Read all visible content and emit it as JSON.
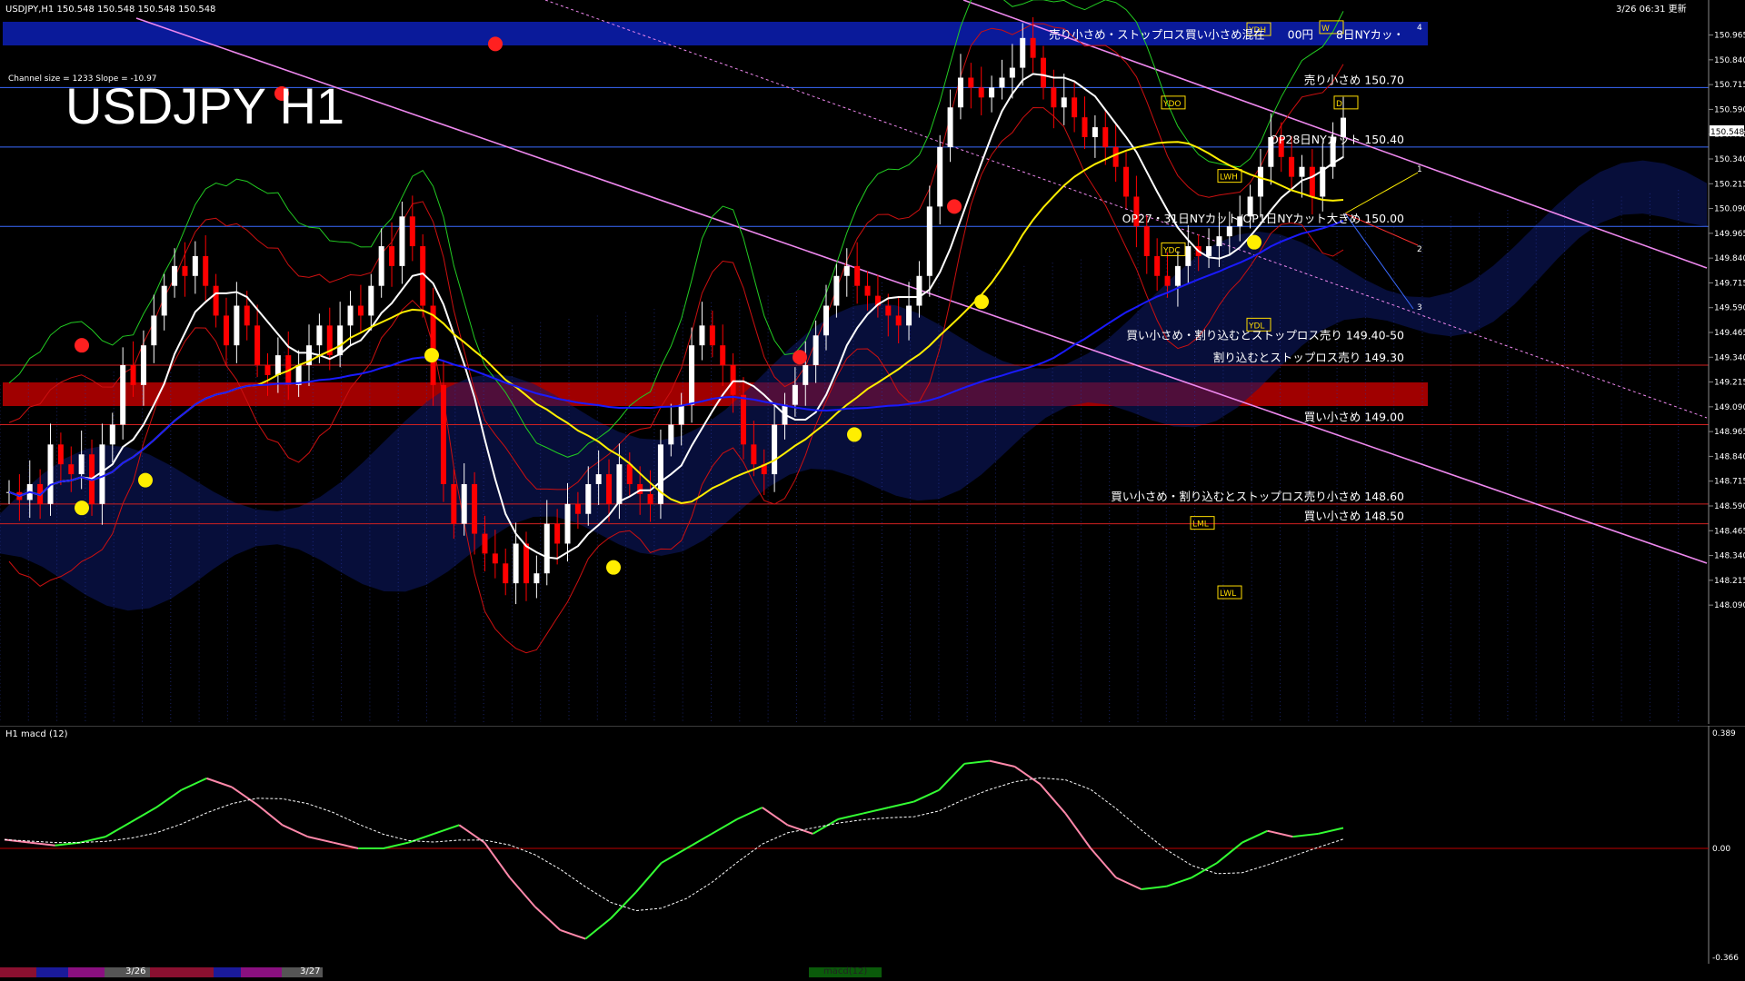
{
  "header": {
    "symbol_line": "USDJPY,H1  150.548 150.548 150.548 150.548",
    "datetime": "3/26 06:31 更新"
  },
  "chart_title": "USDJPY H1",
  "channel_info": "Channel size = 1233 Slope = -10.97",
  "price_axis": {
    "ticks": [
      "150.965",
      "150.840",
      "150.715",
      "150.590",
      "150.465",
      "150.340",
      "150.215",
      "150.090",
      "149.965",
      "149.840",
      "149.715",
      "149.590",
      "149.465",
      "149.340",
      "149.215",
      "149.090",
      "148.965",
      "148.840",
      "148.715",
      "148.590",
      "148.465",
      "148.340",
      "148.215",
      "148.090"
    ],
    "current_price": "150.548",
    "range": [
      148.05,
      151.05
    ]
  },
  "annotations": [
    {
      "text": "売り小さめ・ストップロス買い小さめ混在　　00円　　8日NYカッ・",
      "price": 150.965,
      "band": "blue"
    },
    {
      "text": "売り小さめ 150.70",
      "price": 150.7
    },
    {
      "text": "OP28日NYカット 150.40",
      "price": 150.4
    },
    {
      "text": "OP27・31日NYカット/OP1日NYカット大きめ 150.00",
      "price": 150.0
    },
    {
      "text": "買い小さめ・割り込むとストップロス売り 149.40-50",
      "price": 149.45,
      "band": "red"
    },
    {
      "text": "割り込むとストップロス売り 149.30",
      "price": 149.3
    },
    {
      "text": "買い小さめ 149.00",
      "price": 149.0
    },
    {
      "text": "買い小さめ・割り込むとストップロス売り小さめ 148.60",
      "price": 148.6
    },
    {
      "text": "買い小さめ 148.50",
      "price": 148.5
    }
  ],
  "level_tags": [
    "YDH",
    "YDO",
    "YDC",
    "YDL",
    "LWH",
    "LWL",
    "LML",
    "W",
    "D"
  ],
  "channel_numbers": [
    "4",
    "1",
    "2",
    "3"
  ],
  "macd": {
    "title": "H1  macd (12)",
    "ticks": [
      "0.389",
      "0.00",
      "-0.366"
    ]
  },
  "bottom_bar": {
    "dates": [
      "3/26",
      "3/27"
    ],
    "label": "macd(12)"
  },
  "colors": {
    "background": "#000000",
    "bull": "#ffffff",
    "bear": "#ff0000",
    "sma_fast": "#ffffff",
    "sma_mid": "#ffee00",
    "sma_slow": "#1a1aff",
    "channel": "#ee88ee",
    "macd_up": "#33ff33",
    "macd_down": "#ff88aa",
    "signal": "#ffffff",
    "blue_band": "#0a1a9a",
    "red_band": "#a00000"
  },
  "chart_data": {
    "type": "candlestick",
    "timeframe": "H1",
    "symbol": "USDJPY",
    "ylim": [
      148.05,
      151.05
    ],
    "close_path": [
      148.66,
      148.62,
      148.7,
      148.6,
      148.9,
      148.8,
      148.75,
      148.85,
      148.6,
      148.9,
      149.0,
      149.3,
      149.2,
      149.4,
      149.55,
      149.7,
      149.8,
      149.75,
      149.85,
      149.7,
      149.55,
      149.4,
      149.6,
      149.5,
      149.3,
      149.25,
      149.35,
      149.2,
      149.3,
      149.4,
      149.5,
      149.35,
      149.5,
      149.6,
      149.55,
      149.7,
      149.9,
      149.8,
      150.05,
      149.9,
      149.6,
      149.2,
      148.7,
      148.5,
      148.7,
      148.45,
      148.35,
      148.3,
      148.2,
      148.4,
      148.2,
      148.25,
      148.5,
      148.4,
      148.6,
      148.55,
      148.7,
      148.75,
      148.6,
      148.8,
      148.7,
      148.65,
      148.6,
      148.9,
      149.0,
      149.1,
      149.4,
      149.5,
      149.4,
      149.3,
      149.15,
      148.9,
      148.8,
      148.75,
      149.0,
      149.1,
      149.2,
      149.3,
      149.45,
      149.6,
      149.75,
      149.8,
      149.7,
      149.65,
      149.6,
      149.55,
      149.5,
      149.6,
      149.75,
      150.1,
      150.4,
      150.6,
      150.75,
      150.7,
      150.65,
      150.7,
      150.75,
      150.8,
      150.95,
      150.85,
      150.7,
      150.6,
      150.65,
      150.55,
      150.45,
      150.5,
      150.4,
      150.3,
      150.15,
      150.0,
      149.85,
      149.75,
      149.7,
      149.8,
      149.9,
      149.85,
      149.9,
      149.95,
      150.0,
      150.05,
      150.15,
      150.3,
      150.45,
      150.35,
      150.25,
      150.3,
      150.15,
      150.3,
      150.45,
      150.548
    ],
    "macd_values": [
      0.03,
      0.02,
      0.01,
      0.02,
      0.04,
      0.09,
      0.14,
      0.2,
      0.24,
      0.21,
      0.15,
      0.08,
      0.04,
      0.02,
      0.0,
      0.0,
      0.02,
      0.05,
      0.08,
      0.02,
      -0.1,
      -0.2,
      -0.28,
      -0.31,
      -0.24,
      -0.15,
      -0.05,
      0.0,
      0.05,
      0.1,
      0.14,
      0.08,
      0.05,
      0.1,
      0.12,
      0.14,
      0.16,
      0.2,
      0.29,
      0.3,
      0.28,
      0.22,
      0.12,
      0.0,
      -0.1,
      -0.14,
      -0.13,
      -0.1,
      -0.05,
      0.02,
      0.06,
      0.04,
      0.05,
      0.07
    ]
  }
}
